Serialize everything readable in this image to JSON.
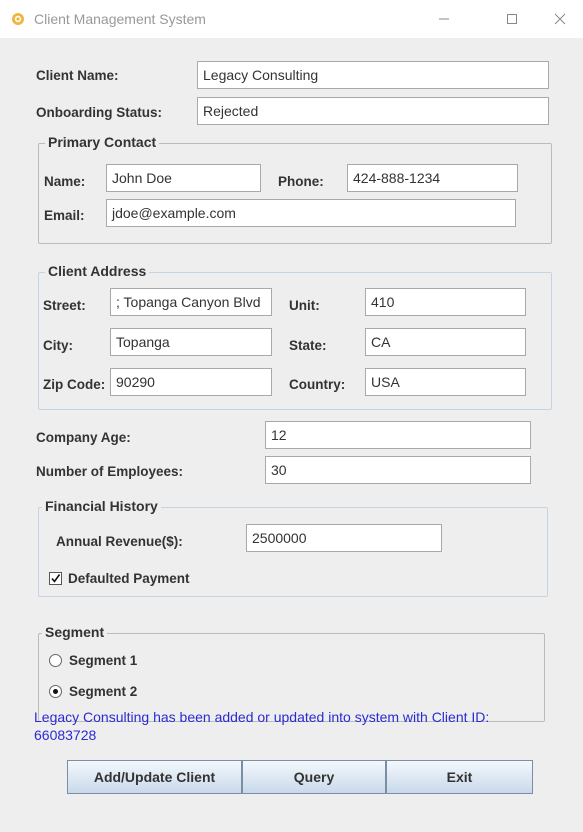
{
  "window": {
    "title": "Client Management System",
    "icon": "app-gear-icon",
    "controls": [
      "minimize",
      "maximize",
      "close"
    ]
  },
  "client": {
    "name_label": "Client Name:",
    "name_value": "Legacy Consulting",
    "status_label": "Onboarding Status:",
    "status_value": "Rejected"
  },
  "primary_contact": {
    "legend": "Primary Contact",
    "name_label": "Name:",
    "name_value": "John Doe",
    "phone_label": "Phone:",
    "phone_value": "424-888-1234",
    "email_label": "Email:",
    "email_value": "jdoe@example.com"
  },
  "address": {
    "legend": "Client Address",
    "street_label": "Street:",
    "street_value": "; Topanga Canyon Blvd",
    "unit_label": "Unit:",
    "unit_value": "410",
    "city_label": "City:",
    "city_value": "Topanga",
    "state_label": "State:",
    "state_value": "CA",
    "zip_label": "Zip Code:",
    "zip_value": "90290",
    "country_label": "Country:",
    "country_value": "USA"
  },
  "company": {
    "age_label": "Company Age:",
    "age_value": "12",
    "employees_label": "Number of Employees:",
    "employees_value": "30"
  },
  "financial": {
    "legend": "Financial History",
    "revenue_label": "Annual Revenue($):",
    "revenue_value": "2500000",
    "defaulted_label": "Defaulted Payment",
    "defaulted_checked": true
  },
  "segment": {
    "legend": "Segment",
    "options": [
      {
        "label": "Segment 1",
        "selected": false
      },
      {
        "label": "Segment 2",
        "selected": true
      }
    ]
  },
  "message": "Legacy Consulting has been added or updated into system with Client ID: 66083728",
  "buttons": {
    "add_update": "Add/Update Client",
    "query": "Query",
    "exit": "Exit"
  },
  "colors": {
    "message_text": "#2b2bd6",
    "button_top": "#f4f8fc",
    "button_bottom": "#c9d9ea",
    "window_bg": "#eeeeee"
  }
}
